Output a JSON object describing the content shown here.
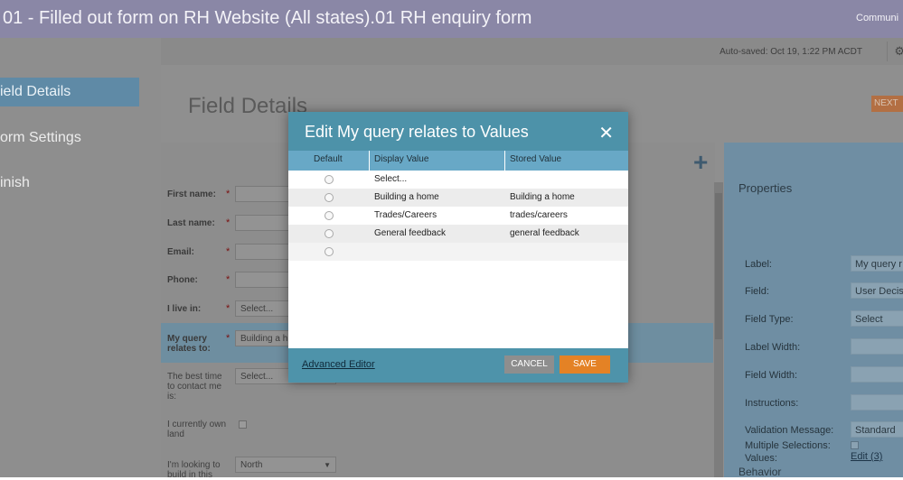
{
  "header": {
    "title": "01 - Filled out form on RH Website (All states).01 RH enquiry form",
    "right_text": "Communi"
  },
  "nav": {
    "items": [
      {
        "label": "ield Details"
      },
      {
        "label": "orm Settings"
      },
      {
        "label": "inish"
      }
    ]
  },
  "status": {
    "autosave": "Auto-saved: Oct 19, 1:22 PM ACDT"
  },
  "main": {
    "heading": "Field Details",
    "next_label": "NEXT"
  },
  "form": {
    "fields": [
      {
        "label": "First name:",
        "required": "*",
        "value": ""
      },
      {
        "label": "Last name:",
        "required": "*",
        "value": ""
      },
      {
        "label": "Email:",
        "required": "*",
        "value": ""
      },
      {
        "label": "Phone:",
        "required": "*",
        "value": ""
      },
      {
        "label": "I live in:",
        "required": "*",
        "value": "Select..."
      },
      {
        "label": "My query relates to:",
        "required": "*",
        "value": "Building a h"
      },
      {
        "label": "The best time to contact me is:",
        "required": "",
        "value": "Select..."
      },
      {
        "label": "I currently own land",
        "required": "",
        "value": ""
      },
      {
        "label": "I'm looking to build in this",
        "required": "",
        "value": "North"
      }
    ]
  },
  "properties": {
    "title": "Properties",
    "rows": [
      {
        "label": "Label:",
        "value": "My query r"
      },
      {
        "label": "Field:",
        "value": "User Decisi"
      },
      {
        "label": "Field Type:",
        "value": "Select"
      },
      {
        "label": "Label Width:",
        "value": ""
      },
      {
        "label": "Field Width:",
        "value": ""
      },
      {
        "label": "Instructions:",
        "value": ""
      },
      {
        "label": "Validation Message:",
        "value": "Standard"
      },
      {
        "label": "Values:",
        "value": "Edit (3)"
      },
      {
        "label": "Multiple Selections:",
        "value": ""
      }
    ],
    "behavior": "Behavior"
  },
  "modal": {
    "title": "Edit My query relates to Values",
    "columns": [
      "Default",
      "Display Value",
      "Stored Value"
    ],
    "rows": [
      {
        "display": "Select...",
        "stored": ""
      },
      {
        "display": "Building a home",
        "stored": "Building a home"
      },
      {
        "display": "Trades/Careers",
        "stored": "trades/careers"
      },
      {
        "display": "General feedback",
        "stored": "general feedback"
      },
      {
        "display": "",
        "stored": ""
      }
    ],
    "advanced_editor": "Advanced Editor",
    "cancel": "CANCEL",
    "save": "SAVE"
  },
  "icons": {
    "close": "close-icon",
    "add": "plus-icon",
    "settings": "gear-icon",
    "dropdown": "chevron-down-icon"
  }
}
